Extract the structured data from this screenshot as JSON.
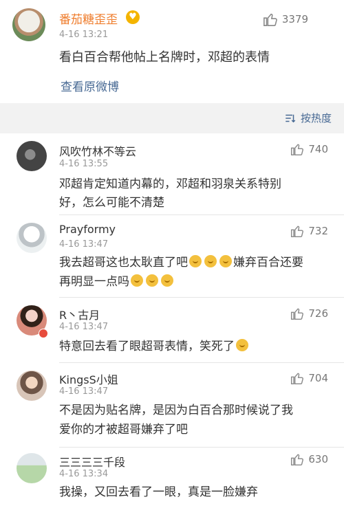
{
  "top_post": {
    "username": "番茄糖歪歪",
    "timestamp": "4-16 13:21",
    "likes": "3379",
    "text": "看白百合帮他帖上名牌时，邓超的表情",
    "view_original": "查看原微博"
  },
  "sort": {
    "label": "按热度"
  },
  "comments": [
    {
      "username": "风吹竹林不等云",
      "timestamp": "4-16 13:55",
      "likes": "740",
      "text_line1": "邓超肯定知道内幕的，邓超和羽泉关系特别",
      "text_line2": "好，怎么可能不清楚"
    },
    {
      "username": "Prayformy",
      "timestamp": "4-16 13:47",
      "likes": "732",
      "text_line1a": "我去超哥这也太耿直了吧",
      "text_line1b": "嫌弃百合还要",
      "text_line2": "再明显一点吗"
    },
    {
      "username": "R丶古月",
      "timestamp": "4-16 13:47",
      "likes": "726",
      "text": "特意回去看了眼超哥表情，笑死了"
    },
    {
      "username": "KingsS小姐",
      "timestamp": "4-16 13:47",
      "likes": "704",
      "text_line1": "不是因为贴名牌，是因为白百合那时候说了我",
      "text_line2": "爱你的才被超哥嫌弃了吧"
    },
    {
      "username": "三三三三千段",
      "timestamp": "4-16 13:34",
      "likes": "630",
      "text": "我操，又回去看了一眼，真是一脸嫌弃"
    }
  ],
  "colors": {
    "username_top": "#ef7d2d",
    "link": "#466893",
    "like": "#777777"
  }
}
